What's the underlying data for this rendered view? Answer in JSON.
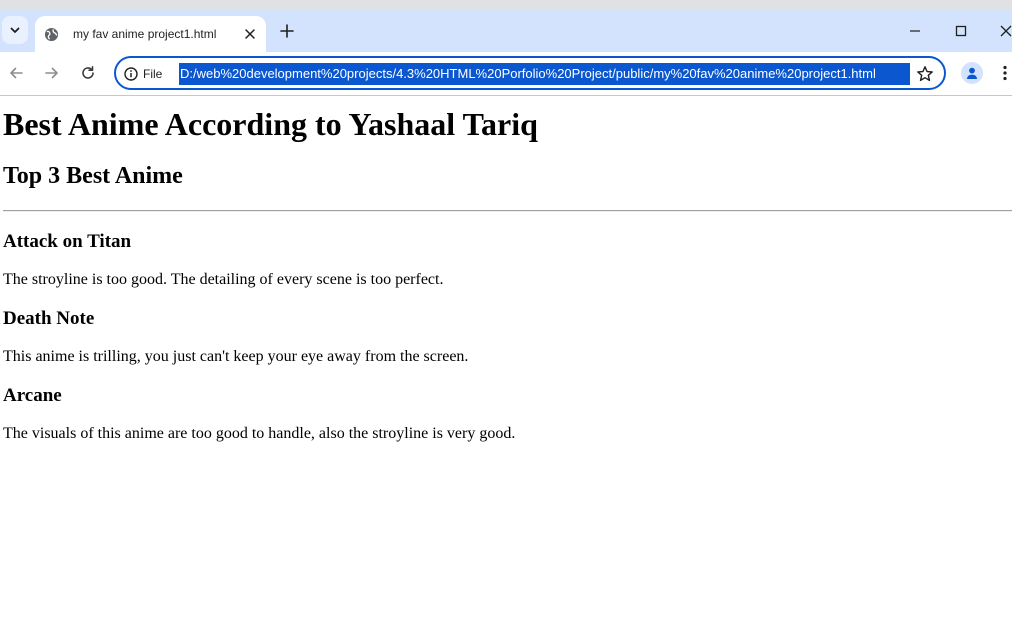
{
  "browser": {
    "tab": {
      "title": "my fav anime project1.html"
    },
    "site_info_label": "File",
    "url": "D:/web%20development%20projects/4.3%20HTML%20Porfolio%20Project/public/my%20fav%20anime%20project1.html",
    "accent_color": "#0b57d0",
    "tabstrip_color": "#d3e3fd",
    "icons": {
      "tab_search": "chevron-down-icon",
      "favicon": "globe-icon",
      "tab_close": "close-icon",
      "new_tab": "plus-icon",
      "minimize": "minimize-icon",
      "maximize": "maximize-icon",
      "window_close": "close-icon",
      "back": "arrow-left-icon",
      "forward": "arrow-right-icon",
      "reload": "reload-icon",
      "site_info": "info-icon",
      "bookmark": "star-icon",
      "profile": "person-icon",
      "menu": "kebab-menu-icon"
    }
  },
  "page": {
    "title": "Best Anime According to Yashaal Tariq",
    "subtitle": "Top 3 Best Anime",
    "anime": [
      {
        "name": "Attack on Titan",
        "description": "The stroyline is too good. The detailing of every scene is too perfect."
      },
      {
        "name": "Death Note",
        "description": "This anime is trilling, you just can't keep your eye away from the screen."
      },
      {
        "name": "Arcane",
        "description": "The visuals of this anime are too good to handle, also the stroyline is very good."
      }
    ]
  }
}
